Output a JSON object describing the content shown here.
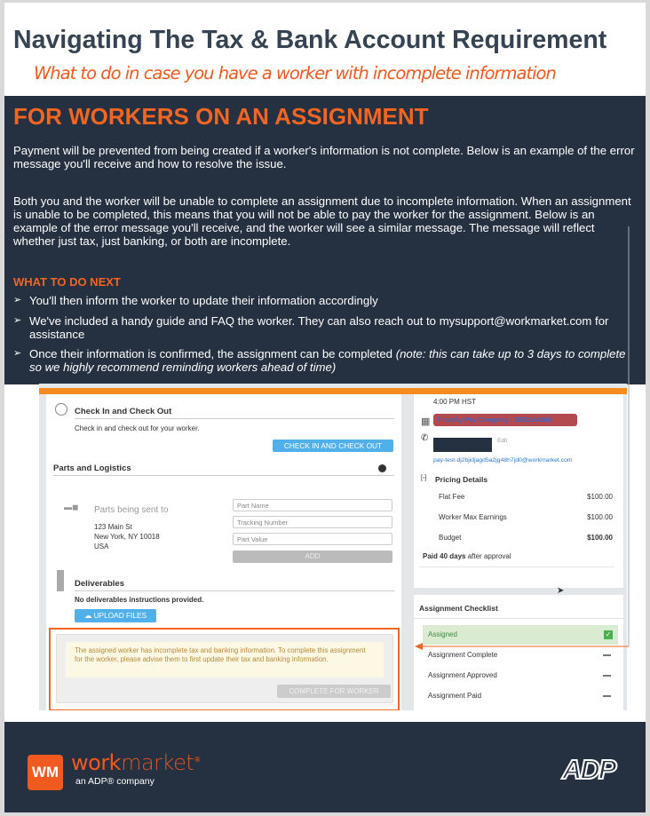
{
  "title": "Navigating The Tax & Bank Account Requirement",
  "subtitle": "What to do in case you have a worker with incomplete information",
  "section": {
    "heading": "FOR WORKERS ON AN ASSIGNMENT",
    "para1": "Payment will be prevented from being created if a worker's information is not complete. Below is an example of the error message you'll receive and how to resolve the issue.",
    "para2": "Both you and the worker will be unable to complete an assignment due to incomplete information. When an assignment is unable to be completed, this means that you will not be able to pay the worker for the assignment. Below is an example of the error message you'll receive, and the worker will see a similar message. The message will reflect whether just tax, just banking, or both are incomplete.",
    "what_next": "WHAT TO DO NEXT",
    "bullet1": "You'll then inform the worker to update their information accordingly",
    "bullet2_pre": "We've included a handy guide and FAQ the worker. They can also reach out to ",
    "bullet2_link": "mysupport@workmarket.com",
    "bullet2_post": " for assistance",
    "bullet3": " Once their information is confirmed, the assignment can be completed ",
    "bullet3_note": "(note: this can take up to 3 days to complete so we highly recommend reminding workers ahead of time)"
  },
  "shot": {
    "checkin_title": "Check In and Check Out",
    "checkin_desc": "Check in and check out for your worker.",
    "checkin_button": "CHECK IN AND CHECK OUT",
    "parts_title": "Parts and Logistics",
    "parts_sent": "Parts being sent to",
    "addr1": "123 Main St",
    "addr2": "New York, NY 10018",
    "addr3": "USA",
    "part_name_ph": "Part Name",
    "tracking_ph": "Tracking Number",
    "part_value_ph": "Part Value",
    "add_button": "ADD",
    "deliverables_title": "Deliverables",
    "deliverables_desc": "No deliverables instructions provided.",
    "upload_button": "UPLOAD FILES",
    "error_msg": "The assigned worker has incomplete tax and banking information. To complete this assignment for the worker, please advise them to first update their tax and banking information.",
    "complete_button": "COMPLETE FOR WORKER",
    "time": "4:00 PM HST",
    "company": "Timothy Pay Company - 1531164264",
    "edit": "Edit",
    "email": "pay-test-dj2bjidjagd5a2jg48h7jd0@workmarket.com",
    "pricing_title": "Pricing Details",
    "pricing": [
      {
        "label": "Flat Fee",
        "value": "$100.00"
      },
      {
        "label": "Worker Max Earnings",
        "value": "$100.00"
      },
      {
        "label": "Budget",
        "value": "$100.00"
      }
    ],
    "paid_bold": "Paid 40 days",
    "paid_rest": " after approval",
    "checklist_title": "Assignment Checklist",
    "checklist": [
      {
        "label": "Assigned",
        "done": true
      },
      {
        "label": "Assignment Complete",
        "done": false
      },
      {
        "label": "Assignment Approved",
        "done": false
      },
      {
        "label": "Assignment Paid",
        "done": false
      }
    ]
  },
  "footer": {
    "brand_a": "work",
    "brand_b": "market",
    "tagline": "an ADP® company",
    "adp": "ADP"
  },
  "colors": {
    "navy": "#253041",
    "orange": "#f26522",
    "blue": "#4fb0ea"
  }
}
